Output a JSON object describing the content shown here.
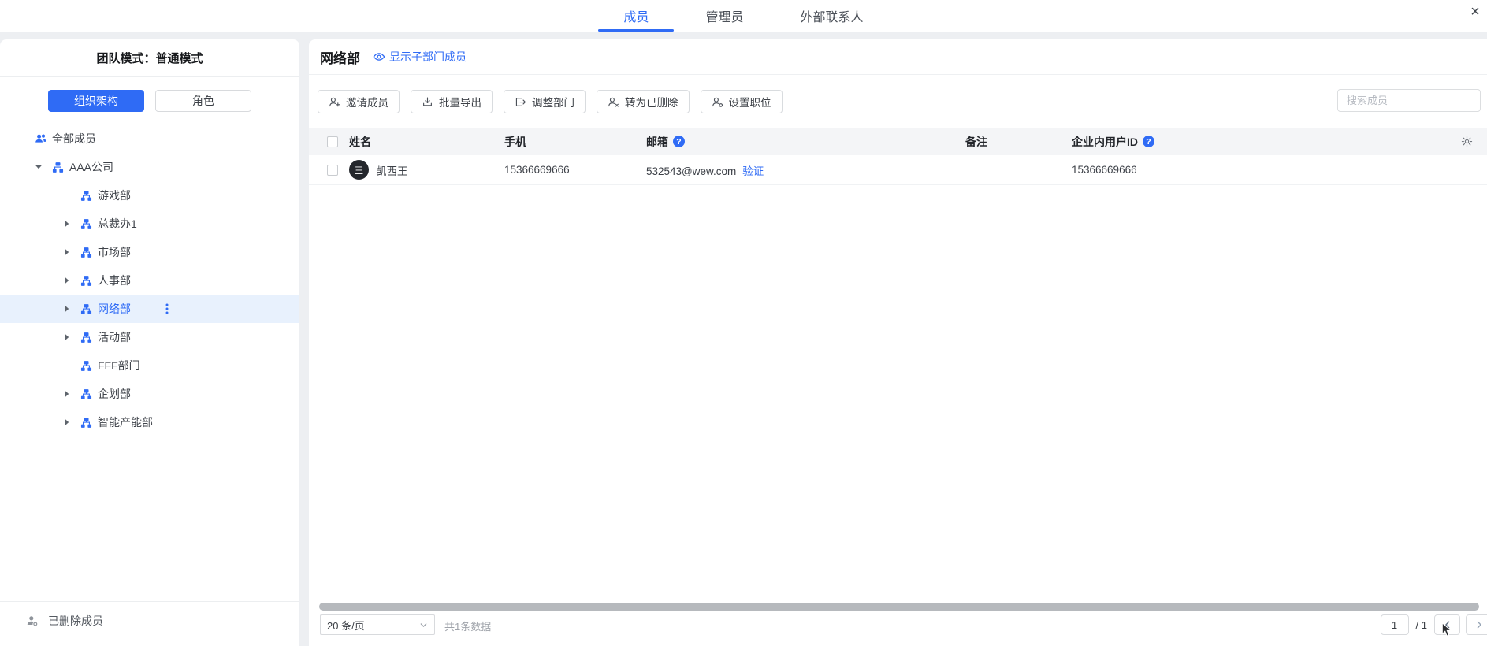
{
  "topbar": {
    "tabs": [
      {
        "label": "成员",
        "active": true
      },
      {
        "label": "管理员",
        "active": false
      },
      {
        "label": "外部联系人",
        "active": false
      }
    ],
    "close_glyph": "×"
  },
  "sidebar": {
    "title": "团队模式：普通模式",
    "toggle": {
      "org": "组织架构",
      "role": "角色"
    },
    "all_members": "全部成员",
    "tree": [
      {
        "label": "AAA公司",
        "level": 0,
        "arrow": "down",
        "selected": false,
        "menu": false
      },
      {
        "label": "游戏部",
        "level": 1,
        "arrow": "none",
        "selected": false,
        "menu": false
      },
      {
        "label": "总裁办1",
        "level": 1,
        "arrow": "right",
        "selected": false,
        "menu": false
      },
      {
        "label": "市场部",
        "level": 1,
        "arrow": "right",
        "selected": false,
        "menu": false
      },
      {
        "label": "人事部",
        "level": 1,
        "arrow": "right",
        "selected": false,
        "menu": false
      },
      {
        "label": "网络部",
        "level": 1,
        "arrow": "right",
        "selected": true,
        "menu": true
      },
      {
        "label": "活动部",
        "level": 1,
        "arrow": "right",
        "selected": false,
        "menu": false
      },
      {
        "label": "FFF部门",
        "level": 1,
        "arrow": "none",
        "selected": false,
        "menu": false
      },
      {
        "label": "企划部",
        "level": 1,
        "arrow": "right",
        "selected": false,
        "menu": false
      },
      {
        "label": "智能产能部",
        "level": 1,
        "arrow": "right",
        "selected": false,
        "menu": false
      }
    ],
    "deleted_members": "已删除成员"
  },
  "main": {
    "title": "网络部",
    "show_sub_label": "显示子部门成员",
    "toolbar": [
      {
        "label": "邀请成员",
        "icon": "person-add-icon"
      },
      {
        "label": "批量导出",
        "icon": "download-icon"
      },
      {
        "label": "调整部门",
        "icon": "dept-move-icon"
      },
      {
        "label": "转为已删除",
        "icon": "person-remove-icon"
      },
      {
        "label": "设置职位",
        "icon": "person-role-icon"
      }
    ],
    "search_placeholder": "搜索成员",
    "table": {
      "columns": [
        {
          "key": "name",
          "label": "姓名",
          "help": false
        },
        {
          "key": "phone",
          "label": "手机",
          "help": false
        },
        {
          "key": "email",
          "label": "邮箱",
          "help": true
        },
        {
          "key": "remark",
          "label": "备注",
          "help": false
        },
        {
          "key": "userid",
          "label": "企业内用户ID",
          "help": true
        }
      ],
      "rows": [
        {
          "avatar": "王",
          "name": "凯西王",
          "phone": "15366669666",
          "email": "532543@wew.com",
          "verify_label": "验证",
          "remark": "",
          "userid": "15366669666"
        }
      ]
    },
    "footer": {
      "page_size": "20 条/页",
      "total": "共1条数据",
      "current_page": "1",
      "page_sep": "/ 1"
    }
  },
  "colors": {
    "accent": "#2f6bf5",
    "selected_bg": "#e8f1fd",
    "table_header_bg": "#f4f5f7",
    "page_bg": "#edeff2"
  }
}
